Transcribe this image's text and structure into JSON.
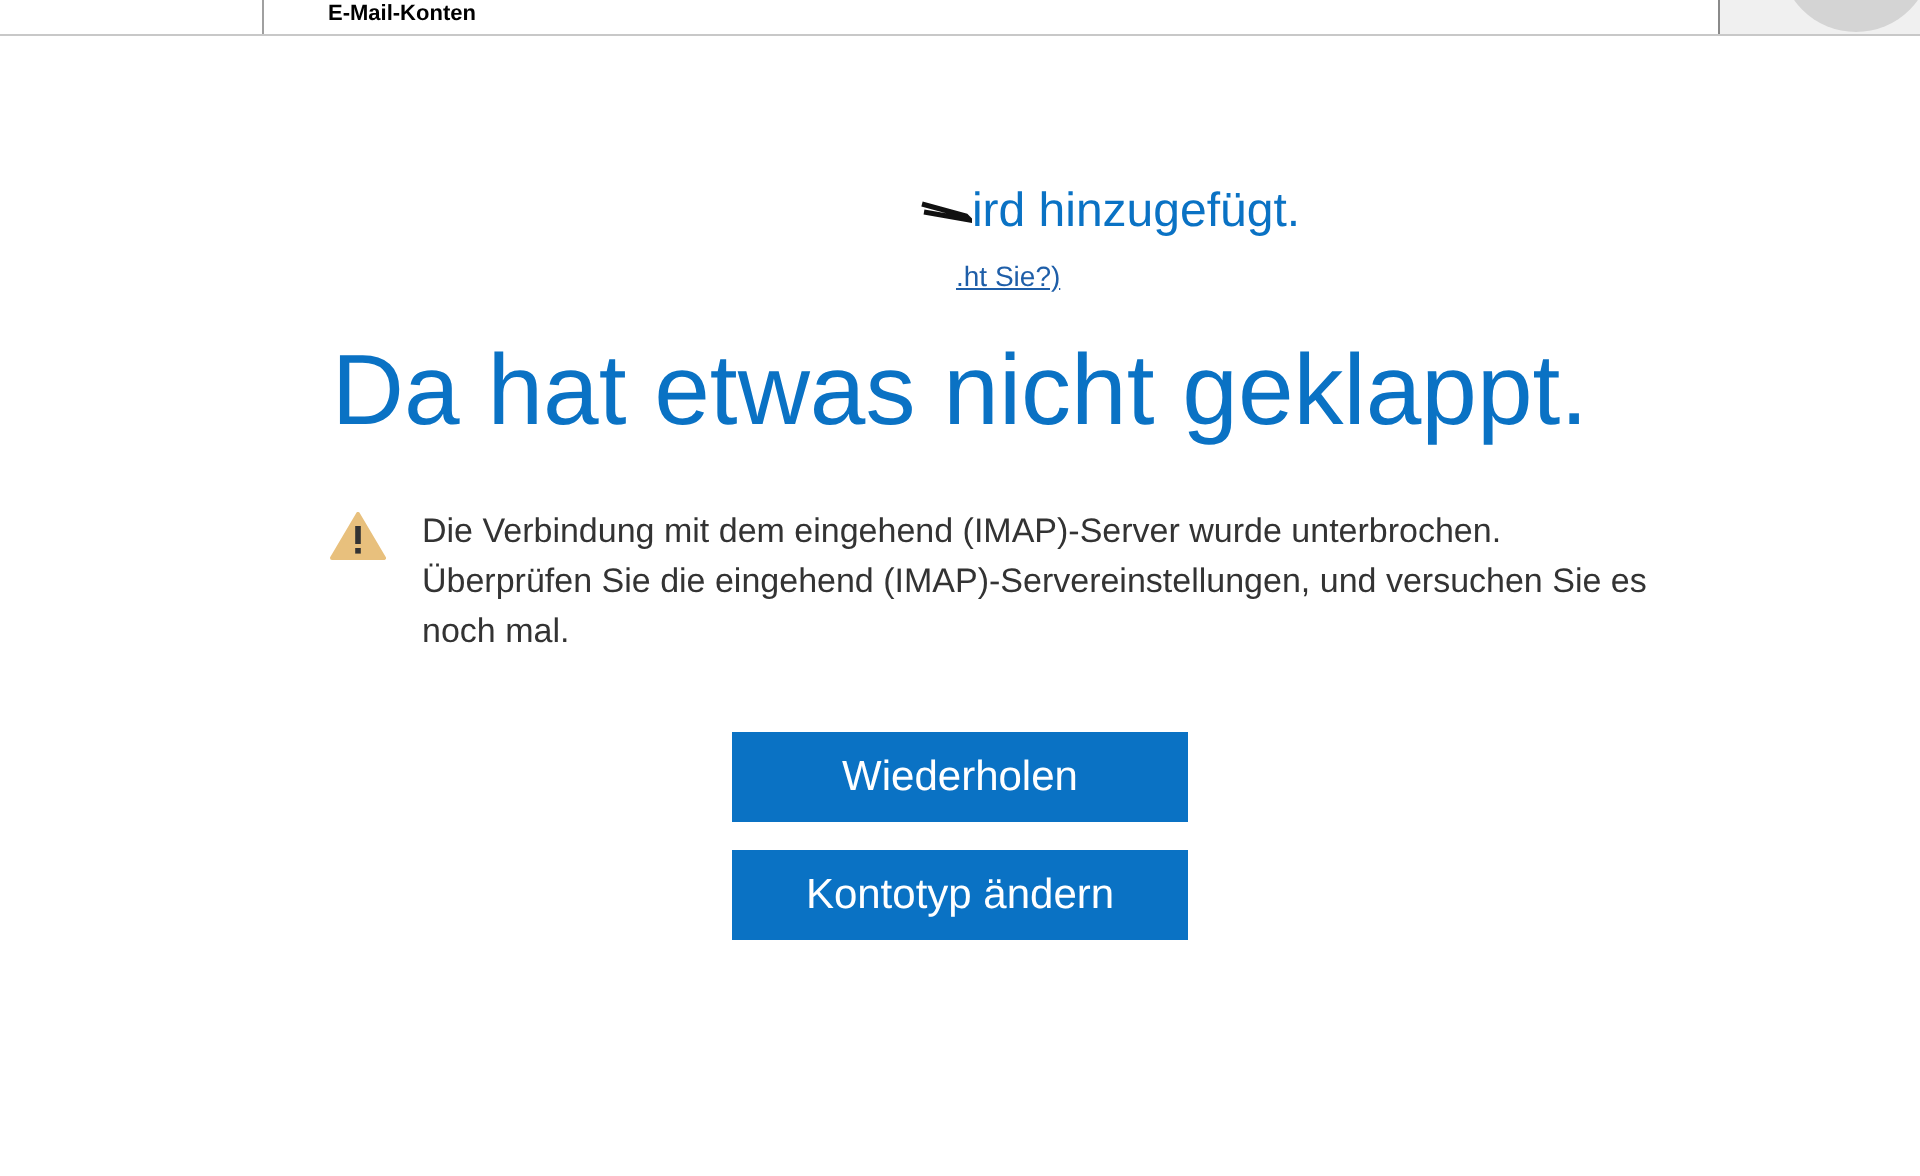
{
  "background_window": {
    "heading": "E-Mail-Konten"
  },
  "dialog": {
    "status": "ird hinzugefügt.",
    "link": ".ht Sie?)",
    "title": "Da hat etwas nicht geklappt.",
    "message": "Die Verbindung mit dem eingehend (IMAP)-Server wurde unterbrochen. Überprüfen Sie die eingehend (IMAP)-Servereinstellungen, und versuchen Sie es noch mal.",
    "buttons": [
      {
        "label": "Wiederholen"
      },
      {
        "label": "Kontotyp ändern"
      }
    ]
  }
}
